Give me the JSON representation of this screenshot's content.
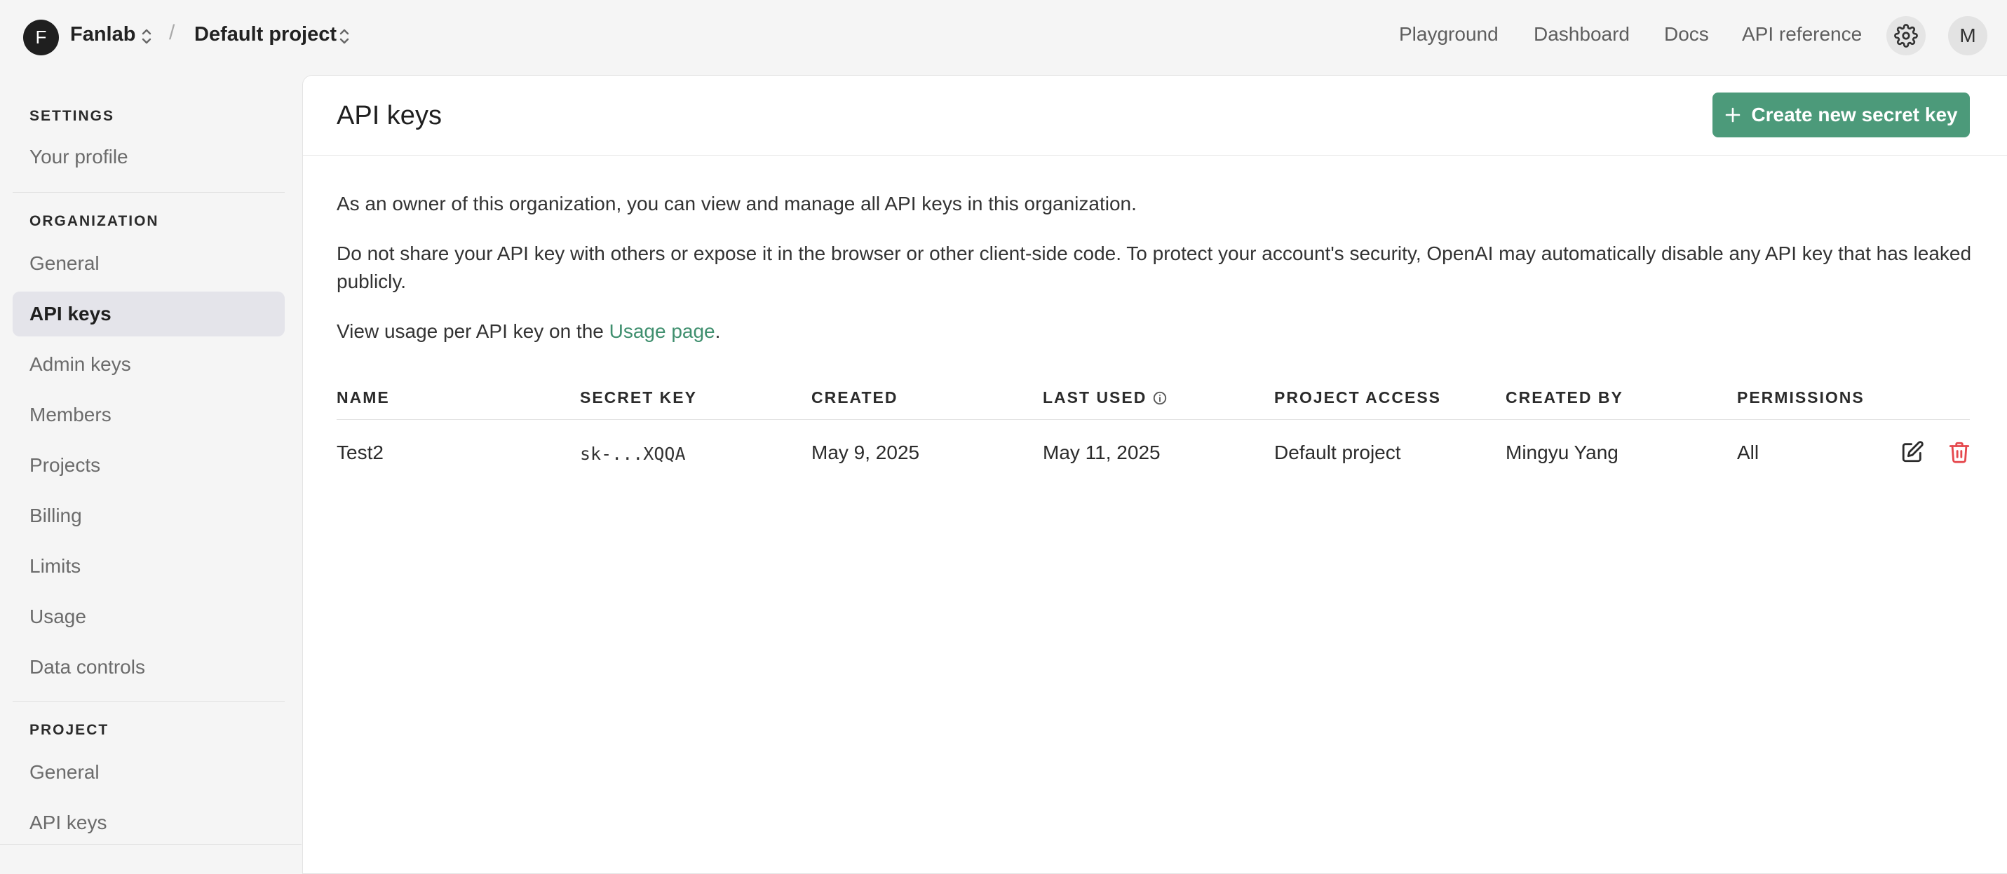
{
  "topbar": {
    "org_initial": "F",
    "org_name": "Fanlab",
    "separator": "/",
    "project_name": "Default project",
    "nav": [
      "Playground",
      "Dashboard",
      "Docs",
      "API reference"
    ],
    "user_initial": "M"
  },
  "sidebar": {
    "settings_heading": "SETTINGS",
    "settings_items": [
      "Your profile"
    ],
    "org_heading": "ORGANIZATION",
    "org_items": [
      "General",
      "API keys",
      "Admin keys",
      "Members",
      "Projects",
      "Billing",
      "Limits",
      "Usage",
      "Data controls"
    ],
    "active_item": "API keys",
    "project_heading": "PROJECT",
    "project_items": [
      "General",
      "API keys"
    ]
  },
  "main": {
    "title": "API keys",
    "create_button": "Create new secret key",
    "intro": "As an owner of this organization, you can view and manage all API keys in this organization.",
    "warning": "Do not share your API key with others or expose it in the browser or other client-side code. To protect your account's security, OpenAI may automatically disable any API key that has leaked publicly.",
    "usage_prefix": "View usage per API key on the ",
    "usage_link": "Usage page",
    "usage_suffix": ".",
    "table": {
      "headers": [
        "NAME",
        "SECRET KEY",
        "CREATED",
        "LAST USED",
        "PROJECT ACCESS",
        "CREATED BY",
        "PERMISSIONS"
      ],
      "rows": [
        {
          "name": "Test2",
          "secret_key": "sk-...XQQA",
          "created": "May 9, 2025",
          "last_used": "May 11, 2025",
          "project_access": "Default project",
          "created_by": "Mingyu Yang",
          "permissions": "All"
        }
      ]
    }
  },
  "colors": {
    "accent": "#4c9a7a",
    "link": "#3f8f6e",
    "delete": "#e5484d",
    "active_bg": "#e4e4ea"
  },
  "icons": [
    "chevron-updown-icon",
    "gear-icon",
    "plus-icon",
    "info-icon",
    "edit-icon",
    "trash-icon"
  ]
}
